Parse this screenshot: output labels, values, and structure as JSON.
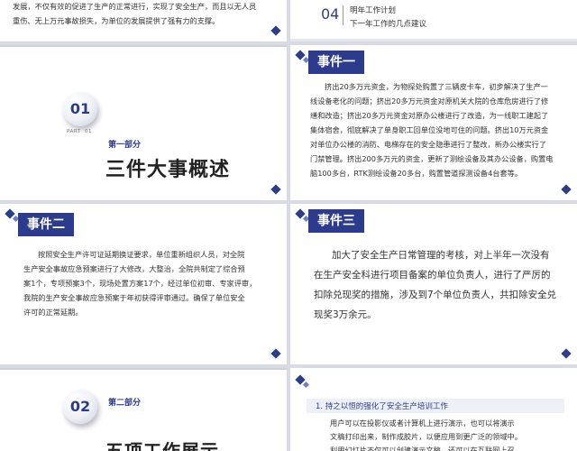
{
  "slide1": {
    "line1": "发展，不仅有效的促进了生产的正常进行，实现了安全生产，而且以无人员",
    "line2": "重伤、无上万元事故损失，为单位的发展提供了强有力的支撑。"
  },
  "slide2": {
    "number": "04",
    "title": "明年工作计划",
    "subtitle": "下一年工作的几点建议"
  },
  "slide3": {
    "number": "01",
    "part_label": "PART  01",
    "section_label": "第一部分",
    "title": "三件大事概述"
  },
  "slide4": {
    "tag": "事件一",
    "lines": [
      "挤出20多万元资金，为物探处购置了三辆皮卡车，初步解决了生产一",
      "线设备老化的问题；挤出20多万元资金对原机关大院的仓库危房进行了修",
      "缮和改造；挤出20多万元资金对原办公楼进行了改造，为一线职工建起了",
      "集体宿舍，彻底解决了单身职工回单位没地可住的问题。挤出10万元资金",
      "对单位办公楼的消防、电梯存在的安全隐患进行了整改，新办公楼实行了",
      "门禁管理。挤出200多万元的资金，更新了测绘设备及其办公设备，购置电",
      "脑100多台，RTK测绘设备20多台，购置管道探测设备4台套等。"
    ]
  },
  "slide5": {
    "tag": "事件二",
    "lines": [
      "按照安全生产许可证延期换证要求，单位重新组织人员，对全院",
      "生产安全事故应急预案进行了大修改，大整治，全院共制定了综合预",
      "案1个，专项预案3个，现场处置方案17个，经过单位初审、专家评审，",
      "我院的生产安全事故应急预案于年初获得评审通过。确保了单位安全",
      "许可的正常延期。"
    ]
  },
  "slide6": {
    "tag": "事件三",
    "lines": [
      "加大了安全生产日常管理的考核，对上半年一次没有",
      "在生产安全科进行项目备案的单位负责人，进行了严厉的",
      "扣除兑现奖的措施，涉及到7个单位负责人，共扣除安全兑",
      "现奖3万余元。"
    ]
  },
  "slide7": {
    "number": "02",
    "section_label": "第二部分",
    "title": "五项工作展示"
  },
  "slide8": {
    "heading": "1. 持之以恒的强化了安全生产培训工作",
    "lines": [
      "用户可以在投影仪或者计算机上进行演示，也可以将演示",
      "文稿打印出来，制作成胶片，以便应用到更广泛的领域中。",
      "利用幻灯片不仅可以创建演示文稿，还可以在互联网上召"
    ]
  },
  "colors": {
    "accent": "#2d3b8c",
    "bar_top": "#3d4f9f"
  }
}
